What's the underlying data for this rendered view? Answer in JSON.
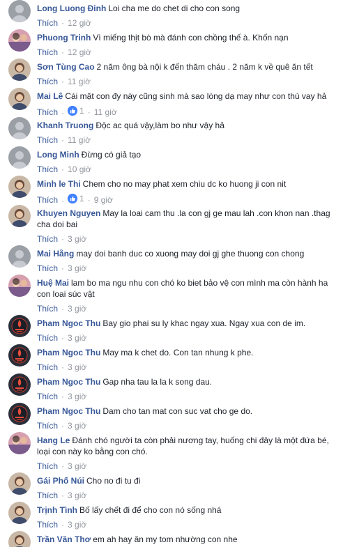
{
  "like_label": "Thích",
  "separator": "·",
  "colors": {
    "author": "#385898",
    "link": "#385898",
    "meta": "#90949c",
    "like_icon": "#4080ff"
  },
  "comments": [
    {
      "author": "Long Luong Đinh",
      "text": "Loi cha me do chet di cho con song",
      "time": "12 giờ",
      "reaction_count": null,
      "avatar": "avatar-gray"
    },
    {
      "author": "Phuong Trinh",
      "text": "Vì miếng thịt bò mà đánh con chồng thế à. Khốn nạn",
      "time": "12 giờ",
      "reaction_count": null,
      "avatar": "avatar-colorful"
    },
    {
      "author": "Sơn Tùng Cao",
      "text": "2 năm ông bà nội k đến thăm cháu . 2 năm k về quê ăn tết",
      "time": "11 giờ",
      "reaction_count": null,
      "avatar": "avatar-person"
    },
    {
      "author": "Mai Lê",
      "text": "Cái mặt con đy này cũng sinh mà sao lòng dạ may như con thú vay hả",
      "time": "11 giờ",
      "reaction_count": "1",
      "avatar": "avatar-person"
    },
    {
      "author": "Khanh Truong",
      "text": "Độc ac quá vậy,làm bo như vậy hả",
      "time": "11 giờ",
      "reaction_count": null,
      "avatar": "avatar-gray"
    },
    {
      "author": "Long Minh",
      "text": "Đừng có giả tạo",
      "time": "10 giờ",
      "reaction_count": null,
      "avatar": "avatar-gray"
    },
    {
      "author": "Minh le Thi",
      "text": "Chem cho no may phat xem chiu dc ko huong ji con nit",
      "time": "9 giờ",
      "reaction_count": "1",
      "avatar": "avatar-person"
    },
    {
      "author": "Khuyen Nguyen",
      "text": "May la loai cam thu .la con gj ge mau lah .con khon nan .thag cha doi bai",
      "time": "3 giờ",
      "reaction_count": null,
      "avatar": "avatar-person"
    },
    {
      "author": "Mai Hằng",
      "text": "may doi banh duc co xuong may doi gj ghe thuong con chong",
      "time": "3 giờ",
      "reaction_count": null,
      "avatar": "avatar-gray"
    },
    {
      "author": "Huệ Mai",
      "text": "lam bo ma ngu nhu con chó ko biet bảo vệ con mình ma còn hành ha con loai súc vật",
      "time": "3 giờ",
      "reaction_count": null,
      "avatar": "avatar-colorful"
    },
    {
      "author": "Pham Ngoc Thu",
      "text": "Bay gio phai su ly khac ngay xua. Ngay xua con de im.",
      "time": "3 giờ",
      "reaction_count": null,
      "avatar": "avatar-logo"
    },
    {
      "author": "Pham Ngoc Thu",
      "text": "May ma k chet do. Con tan nhung k phe.",
      "time": "3 giờ",
      "reaction_count": null,
      "avatar": "avatar-logo"
    },
    {
      "author": "Pham Ngoc Thu",
      "text": "Gap nha tau la la k song dau.",
      "time": "3 giờ",
      "reaction_count": null,
      "avatar": "avatar-logo"
    },
    {
      "author": "Pham Ngoc Thu",
      "text": "Dam cho tan mat con suc vat cho ge do.",
      "time": "3 giờ",
      "reaction_count": null,
      "avatar": "avatar-logo"
    },
    {
      "author": "Hang Le",
      "text": "Đánh chó người ta còn phải nương tay, huống chi đây là một đứa bé, loại con này ko bằng con chó.",
      "time": "3 giờ",
      "reaction_count": null,
      "avatar": "avatar-colorful"
    },
    {
      "author": "Gái Phố Núi",
      "text": "Cho no đi tu đi",
      "time": "3 giờ",
      "reaction_count": null,
      "avatar": "avatar-person"
    },
    {
      "author": "Trịnh Tình",
      "text": "Bố lấy chết đi để cho con nó sống nhá",
      "time": "3 giờ",
      "reaction_count": null,
      "avatar": "avatar-person"
    },
    {
      "author": "Trần Văn Thơ",
      "text": "em ah hay ăn my tom nhường con nhe",
      "time": null,
      "reaction_count": null,
      "avatar": "avatar-person"
    }
  ]
}
